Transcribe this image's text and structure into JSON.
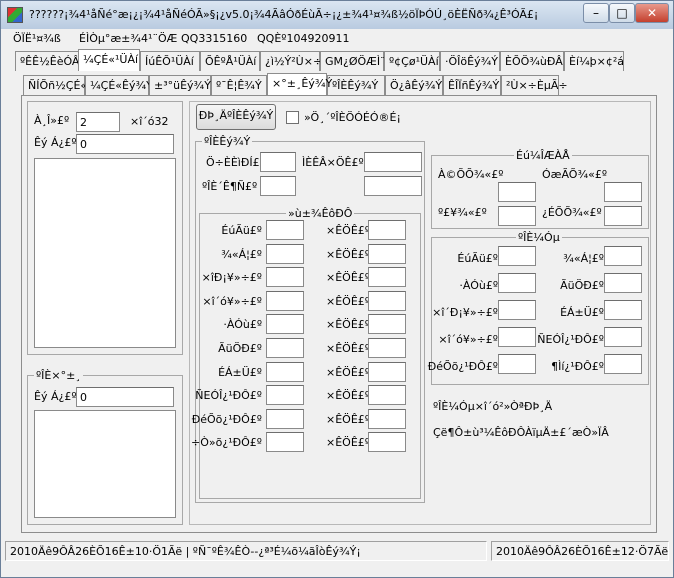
{
  "window": {
    "title": "??????¡¾4¹åÑé°æ¡¿¡¾4¹åÑéÓÃ»§¡¿v5.0¡¾4ÃâÓðÉùÃ÷¡¿±¾4¹¤¾ß½öÏÞÓÚ¸öÈËÑð¾¿Ê³ÓÃ£¡"
  },
  "menu": [
    "ÖÏË¹¤¾ß",
    "ÉÌÒµ°æ±¾4¹¨ÖÆ",
    "QQ3315160",
    "QQÈº104920911"
  ],
  "tabs_row1": [
    "ºÊÊ½ÊèÓÂ",
    "¼ÇÉ«¹ÜÀí",
    "ÍúÊÕ¹ÜÀí",
    "ÕÊºÅ¹ÜÀí",
    "¿ì½Ý²Ù×÷",
    "GM¿ØÖÆÌ¨",
    "º¢Çø¹ÜÀí",
    "·ÖÎöÊý¾Ý",
    "ÈÕÖ¾ùÐÂ",
    "Èí¼þ×¢²á"
  ],
  "tabs_row2": [
    "ÑÍÕñ½ÇÉ«",
    "¼ÇÉ«Êý¾Ý",
    "±³°üÊý¾Ý",
    "º¯Ê¦Ê¾Ý",
    "×°±¸Êý¾Ý",
    "ºÎÈÊý¾Ý",
    "Ö¿âÊý¾Ý",
    "ÊÎÏñÊý¾Ý",
    "²Ù×÷ÈµÃ÷"
  ],
  "left": {
    "name_label": "À¸Î»£º",
    "name_value": "2",
    "count_label": "×î´ó32",
    "id_label": "Êý Á¿£º",
    "id_value": "0",
    "group2_title": "ºÎÈ×°±¸",
    "id2_label": "Êý Á¿£º",
    "id2_value": "0"
  },
  "main": {
    "read_button": "ÐÞ¸ÄºÎÈÊý¾Ý",
    "auto_check_label": "»Ö¸´ºÎÈÖÓÉÓ®É¡",
    "data_group_title": "ºÎÈÊý¾Ý",
    "row1_left": "Ö÷ÈÈìÐÍ£º",
    "row1_right": "ÌÈÊÂ×ÖÊ£º",
    "row2_left": "ºÎÈ´Ê¶Ñ£º",
    "attr_group_title": "»ù±¾ÊôÐÔ",
    "attr_left": [
      "ÉúÃü£º",
      "¾«Á¦£º",
      "×îÐ¡¥»÷£º",
      "×î´ó¥»÷£º",
      "·ÀÓù£º",
      "ÃüÖÐ£º",
      "ÉÁ±Ü£º",
      "ÑEÓÎ¿¹ÐÔ£º",
      "ÐéÕõ¿¹ÐÔ£º",
      "÷Ò»õ¿¹ÐÔ£º"
    ],
    "attr_right": [
      "×ÊÖÊ£º",
      "×ÊÖÊ£º",
      "×ÊÖÊ£º",
      "×ÊÖÊ£º",
      "×ÊÖÊ£º",
      "×ÊÖÊ£º",
      "×ÊÖÊ£º",
      "×ÊÖÊ£º",
      "×ÊÖÊ£º",
      "×ÊÖÊ£º"
    ],
    "grow_group_title": "Éú¼ÎÆÀÅ",
    "grow_labels": [
      "À©ÕÕ¾«£º",
      "ÓæÃÕ¾«£º",
      "º£¥¾«£º",
      "¿ÉÕÕ¾«£º"
    ],
    "skill_group_title": "ºÎÈ¼Óµ",
    "skill_left": [
      "ÉúÃü£º",
      "·ÀÓù£º",
      "×î´Ð¡¥»÷£º",
      "×î´ó¥»÷£º",
      "ÐéÕõ¿¹ÐÔ£º"
    ],
    "skill_right": [
      "¾«Á¦£º",
      "ÃüÖÐ£º",
      "ÉÁ±Ü£º",
      "ÑEÓÎ¿¹ÐÔ£º",
      "¶Ìí¿¹ÐÔ£º"
    ],
    "note1": "ºÎÈ¼Óµ×î´ó²»ÒªÐÞ¸Ä",
    "note2": "Çë¶Ô±ù³¼ÊôÐÔÀïµÄ±£´æÒ»ÏÂ"
  },
  "status": {
    "left": "2010Äê9ÔÂ26ÈÕ16Ê±10·Ö1Ãë | ºÑ¯ºÊ¾ÊÒ--¿ª³É¼õ¼ãÎòÊý¾Ý¡",
    "right": "2010Äê9ÔÂ26ÈÕ16Ê±12·Ö7Ãë"
  }
}
